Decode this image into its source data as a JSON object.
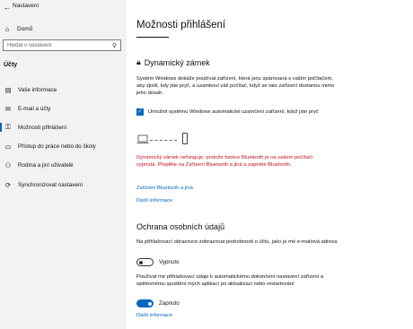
{
  "sidebar": {
    "app_title": "Nastavení",
    "home_label": "Domů",
    "search_placeholder": "Hledat v nastavení",
    "section_title": "Účty",
    "items": [
      {
        "label": "Vaše informace",
        "icon": "person-card-icon"
      },
      {
        "label": "E-mail a účty",
        "icon": "mail-icon"
      },
      {
        "label": "Možnosti přihlášení",
        "icon": "key-icon",
        "active": true
      },
      {
        "label": "Přístup do práce nebo do školy",
        "icon": "briefcase-icon"
      },
      {
        "label": "Rodina a jiní uživatelé",
        "icon": "people-icon"
      },
      {
        "label": "Synchronizovat nastavení",
        "icon": "sync-icon"
      }
    ]
  },
  "main": {
    "title": "Možnosti přihlášení",
    "dynamic_lock": {
      "heading": "Dynamický zámek",
      "description": "Systém Windows dokáže používat zařízení, která jsou spárovaná s vaším počítačem, aby zjistil, kdy jste pryč, a uzamknul váš počítač, když se tato zařízení dostanou mimo jeho dosah.",
      "checkbox_label": "Umožnit systému Windows automatické uzamčení zařízení, když jste pryč",
      "checkbox_checked": true,
      "warning": "Dynamický zámek nefunguje, protože funkce Bluetooth je na vašem počítači vypnutá. Přejděte na Zařízení Bluetooth a jiná a zapněte Bluetooth.",
      "link_bluetooth": "Zařízení Bluetooth a jiná",
      "link_more": "Další informace"
    },
    "privacy": {
      "heading": "Ochrana osobních údajů",
      "setting1_text": "Na přihlašovací obrazovce zobrazovat podrobnosti o účtu, jako je mé e-mailová adresa",
      "setting1_state": "Vypnuto",
      "setting1_on": false,
      "setting2_text": "Používat mé přihlašovací údaje k automatickému dokončení nastavení zařízení a opětovnému spuštění mých aplikací po aktualizaci nebo restartování",
      "setting2_state": "Zapnuto",
      "setting2_on": true,
      "link_more": "Další informace"
    }
  },
  "colors": {
    "accent": "#0067c0",
    "warning": "#c50f1f",
    "sidebar_bg": "#f2f2f2"
  }
}
